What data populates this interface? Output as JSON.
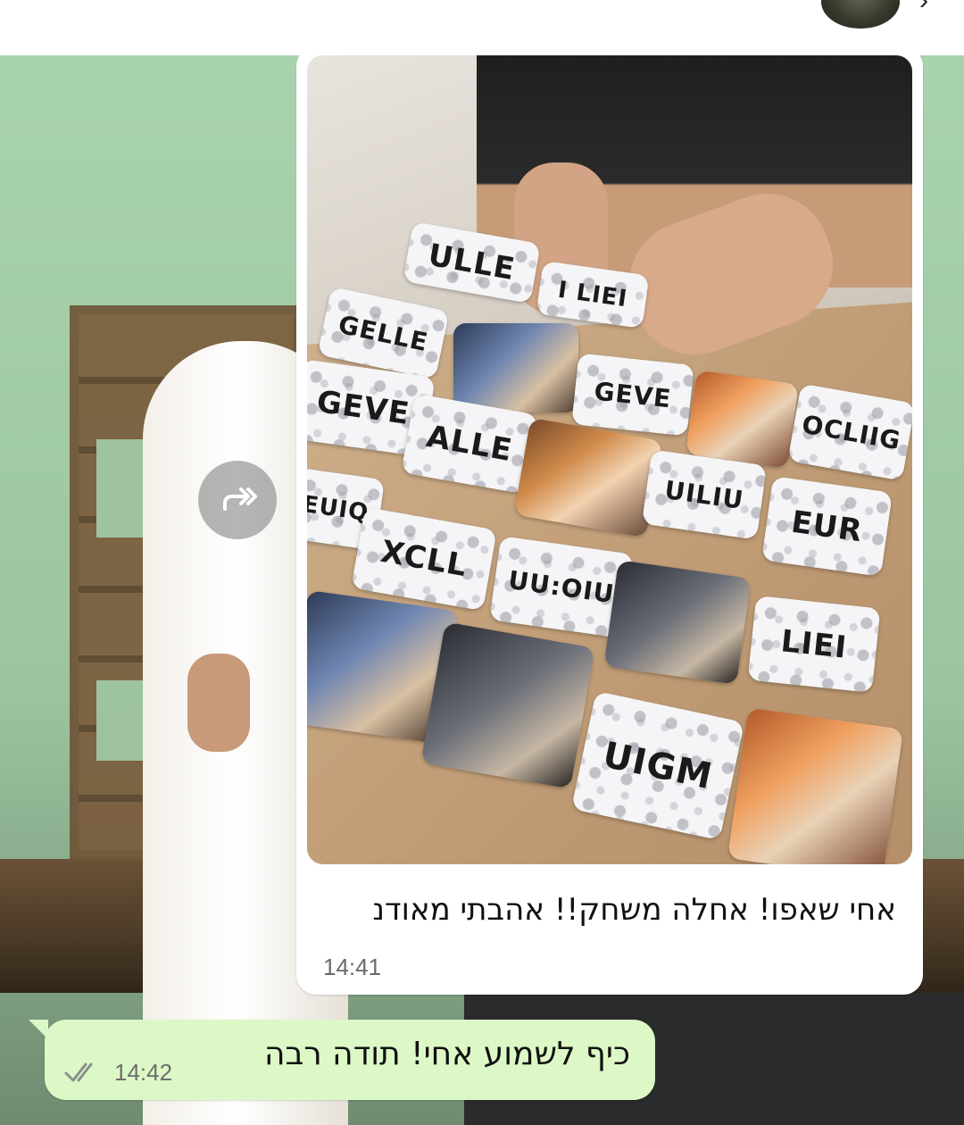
{
  "chat": {
    "incoming": {
      "caption": "אחי שאפו! אחלה משחק!! אהבתי מאודנ",
      "time": "14:41",
      "photo_cards": [
        {
          "text": "ULLE"
        },
        {
          "text": "I LIEI"
        },
        {
          "text": "GELLE"
        },
        {
          "text": "GEVE"
        },
        {
          "text": "OCLIIG"
        },
        {
          "text": "ALLE"
        },
        {
          "text": "EUR"
        },
        {
          "text": "UILIU"
        },
        {
          "text": "EUIQ"
        },
        {
          "text": "XCLL"
        },
        {
          "text": "UU:OIU"
        },
        {
          "text": "LIEI"
        },
        {
          "text": "UIGM"
        }
      ]
    },
    "outgoing": {
      "text": "כיף לשמוע אחי! תודה רבה",
      "time": "14:42",
      "status_icon": "double-check-icon"
    }
  },
  "icons": {
    "forward": "forward-icon",
    "back": "back-arrow-icon",
    "avatar": "contact-avatar"
  },
  "colors": {
    "incoming_bubble": "#ffffff",
    "outgoing_bubble": "#dcf8c6",
    "header_bg": "#ffffff"
  }
}
